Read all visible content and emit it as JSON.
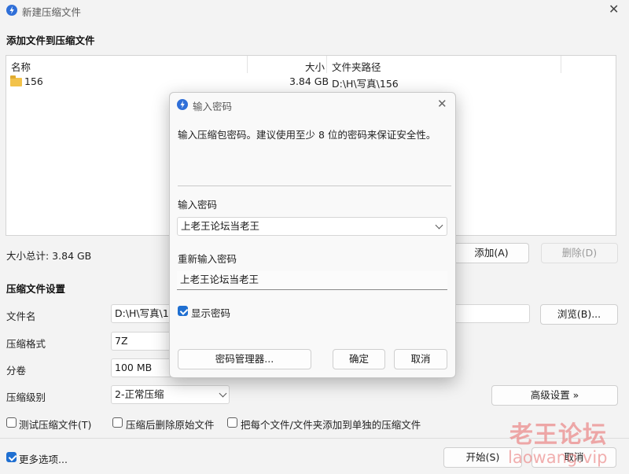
{
  "window": {
    "title": "新建压缩文件",
    "close_icon": "close-icon"
  },
  "files_section": {
    "title": "添加文件到压缩文件"
  },
  "file_table": {
    "columns": [
      "名称",
      "大小",
      "文件夹路径"
    ],
    "rows": [
      {
        "name": "156",
        "size": "3.84 GB",
        "path": "D:\\H\\写真\\156"
      }
    ]
  },
  "total_size": "大小总计: 3.84 GB",
  "buttons": {
    "add": "添加(A)",
    "delete": "删除(D)"
  },
  "settings_section": {
    "title": "压缩文件设置",
    "filename_label": "文件名",
    "filename_value": "D:\\H\\写真\\1!",
    "browse": "浏览(B)...",
    "format_label": "压缩格式",
    "format_value": "7Z",
    "volume_label": "分卷",
    "volume_value": "100 MB",
    "level_label": "压缩级别",
    "level_value": "2-正常压缩",
    "advanced": "高级设置 »"
  },
  "options": {
    "test": "测试压缩文件(T)",
    "delete_after": "压缩后删除原始文件",
    "separate": "把每个文件/文件夹添加到单独的压缩文件",
    "more": "更多选项..."
  },
  "footer": {
    "start": "开始(S)",
    "cancel": "取消"
  },
  "password_dialog": {
    "title": "输入密码",
    "description": "输入压缩包密码。建议使用至少 8 位的密码来保证安全性。",
    "password_label": "输入密码",
    "password_value": "上老王论坛当老王",
    "confirm_label": "重新输入密码",
    "confirm_value": "上老王论坛当老王",
    "show_password": "显示密码",
    "manager": "密码管理器...",
    "ok": "确定",
    "cancel": "取消"
  },
  "watermark": {
    "cn": "老王论坛",
    "en": "laowang.vip"
  },
  "colors": {
    "accent": "#1f6fd1",
    "app_icon": "#2f6fd8",
    "folder": "#f2c24a"
  }
}
